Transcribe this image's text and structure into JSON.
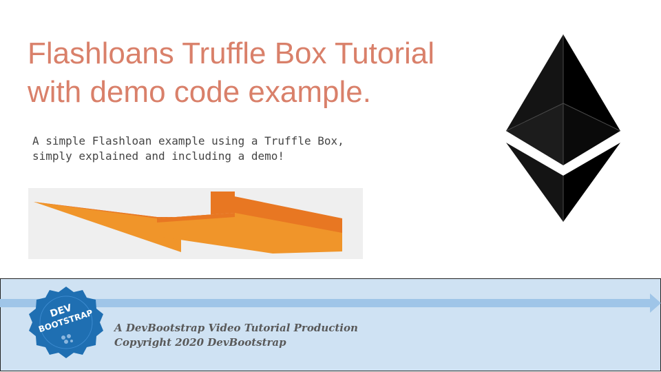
{
  "slide": {
    "title_line1": "Flashloans Truffle Box Tutorial",
    "title_line2": "with demo code example.",
    "subtitle_line1": "A simple Flashloan example using a Truffle Box,",
    "subtitle_line2": "simply explained and including a demo!"
  },
  "footer": {
    "credit_line1": "A DevBootstrap Video Tutorial Production",
    "credit_line2": "Copyright 2020 DevBootstrap",
    "logo_text": [
      "DEV",
      "BOOTSTRAP"
    ]
  },
  "icons": {
    "lightning": "lightning-bolt-icon",
    "ethereum": "ethereum-logo-icon",
    "badge": "devbootstrap-logo-icon"
  },
  "colors": {
    "title": "#d9806a",
    "subtitle": "#444444",
    "footer_band": "#cfe2f3",
    "arrow": "#9fc5e8",
    "bolt_dark": "#e87722",
    "bolt_light": "#f0952a",
    "badge": "#1f6fb2"
  }
}
